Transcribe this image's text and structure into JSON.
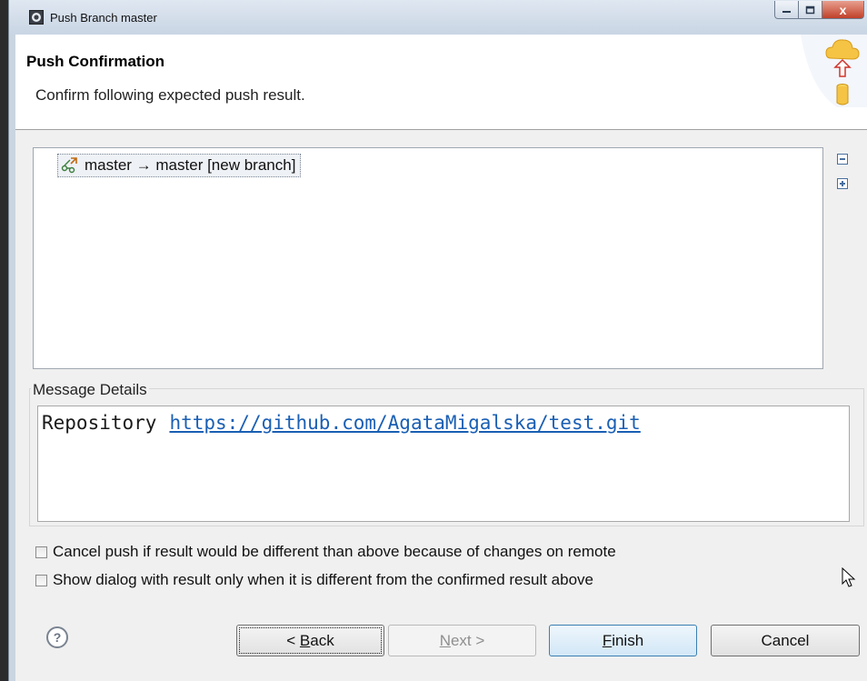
{
  "window": {
    "title": "Push Branch master",
    "controls": {
      "close": "x"
    }
  },
  "header": {
    "title": "Push Confirmation",
    "description": "Confirm following expected push result."
  },
  "tree": {
    "items": [
      {
        "label": "master → master [new branch]"
      }
    ]
  },
  "message_details": {
    "label": "Message Details",
    "repository_label": "Repository",
    "repository_url": "https://github.com/AgataMigalska/test.git"
  },
  "options": {
    "cancel_if_different": {
      "label": "Cancel push if result would be different than above because of changes on remote",
      "checked": false
    },
    "show_only_when_different": {
      "label": "Show dialog with result only when it is different from the confirmed result above",
      "checked": false
    }
  },
  "buttons": {
    "help": "?",
    "back": {
      "prefix": "< ",
      "mnemonic": "B",
      "rest": "ack"
    },
    "next": {
      "mnemonic": "N",
      "rest": "ext >"
    },
    "finish": {
      "mnemonic": "F",
      "rest": "inish"
    },
    "cancel": "Cancel"
  },
  "colors": {
    "link": "#1a5fb4",
    "finish_border": "#3c7fb1",
    "close_button": "#c0412a"
  },
  "icons": [
    "app-icon",
    "push-cloud-icon",
    "branch-push-icon",
    "collapse-all-icon",
    "expand-all-icon",
    "help-icon",
    "cursor-icon"
  ]
}
